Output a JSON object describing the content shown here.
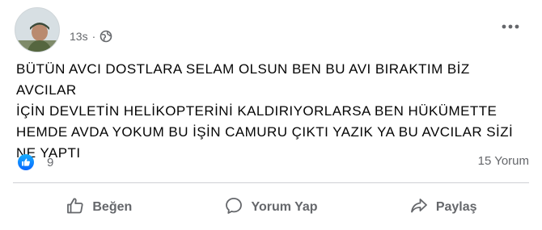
{
  "post": {
    "time": "13s",
    "separator": "·",
    "text": "BÜTÜN AVCI DOSTLARA SELAM OLSUN BEN BU AVI BIRAKTIM BİZ AVCILAR\nİÇİN DEVLETİN HELİKOPTERİNİ KALDIRIYORLARSA BEN HÜKÜMETTE\nHEMDE AVDA YOKUM BU İŞİN CAMURU ÇIKTI YAZIK YA BU AVCILAR SİZİ\nNE YAPTI",
    "reaction_count": "9",
    "comment_count": "15 Yorum"
  },
  "actions": {
    "like": "Beğen",
    "comment": "Yorum Yap",
    "share": "Paylaş"
  },
  "icons": {
    "privacy": "globe-icon",
    "more": "more-options-icon",
    "reaction": "like-reaction-icon",
    "like": "thumbs-up-icon",
    "comment": "comment-bubble-icon",
    "share": "share-arrow-icon"
  },
  "colors": {
    "like_blue": "#0866ff",
    "secondary_text": "#65676b",
    "divider": "#ced0d4"
  }
}
